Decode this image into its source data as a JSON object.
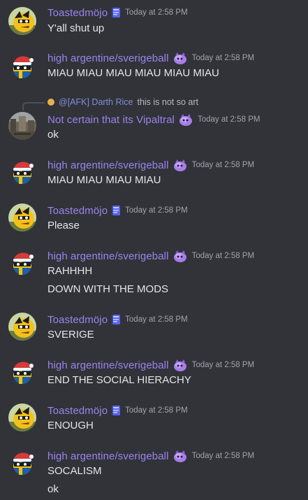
{
  "colors": {
    "background": "#313338",
    "username": "#9b84ee",
    "timestamp": "#a0a4ab",
    "message_text": "#e3e5e8"
  },
  "reply": {
    "author": "@[AFK] Darth Rice",
    "text": "this is not so art"
  },
  "messages": [
    {
      "author": "Toastedmöjo",
      "badge_icon": "book-icon",
      "avatar": "yellow-ball-avatar",
      "time": "Today at 2:58 PM",
      "lines": [
        "Y'all shut up"
      ]
    },
    {
      "author": "high argentine/sverigeball",
      "badge_icon": "purple-creature-icon",
      "avatar": "sverigeball-avatar",
      "time": "Today at 2:58 PM",
      "lines": [
        "MIAU MIAU MIAU MIAU MIAU MIAU"
      ]
    },
    {
      "author": "Not certain that its Vipaltral",
      "badge_icon": "purple-creature-icon",
      "avatar": "photo-avatar",
      "time": "Today at 2:58 PM",
      "lines": [
        "ok"
      ]
    },
    {
      "author": "high argentine/sverigeball",
      "badge_icon": "purple-creature-icon",
      "avatar": "sverigeball-avatar",
      "time": "Today at 2:58 PM",
      "lines": [
        "MIAU MIAU MIAU MIAU"
      ]
    },
    {
      "author": "Toastedmöjo",
      "badge_icon": "book-icon",
      "avatar": "yellow-ball-avatar",
      "time": "Today at 2:58 PM",
      "lines": [
        "Please"
      ]
    },
    {
      "author": "high argentine/sverigeball",
      "badge_icon": "purple-creature-icon",
      "avatar": "sverigeball-avatar",
      "time": "Today at 2:58 PM",
      "lines": [
        "RAHHHH",
        "DOWN WITH THE MODS"
      ]
    },
    {
      "author": "Toastedmöjo",
      "badge_icon": "book-icon",
      "avatar": "yellow-ball-avatar",
      "time": "Today at 2:58 PM",
      "lines": [
        "SVERIGE"
      ]
    },
    {
      "author": "high argentine/sverigeball",
      "badge_icon": "purple-creature-icon",
      "avatar": "sverigeball-avatar",
      "time": "Today at 2:58 PM",
      "lines": [
        "END THE SOCIAL HIERACHY"
      ]
    },
    {
      "author": "Toastedmöjo",
      "badge_icon": "book-icon",
      "avatar": "yellow-ball-avatar",
      "time": "Today at 2:58 PM",
      "lines": [
        "ENOUGH"
      ]
    },
    {
      "author": "high argentine/sverigeball",
      "badge_icon": "purple-creature-icon",
      "avatar": "sverigeball-avatar",
      "time": "Today at 2:58 PM",
      "lines": [
        "SOCALISM",
        "ok"
      ]
    }
  ]
}
